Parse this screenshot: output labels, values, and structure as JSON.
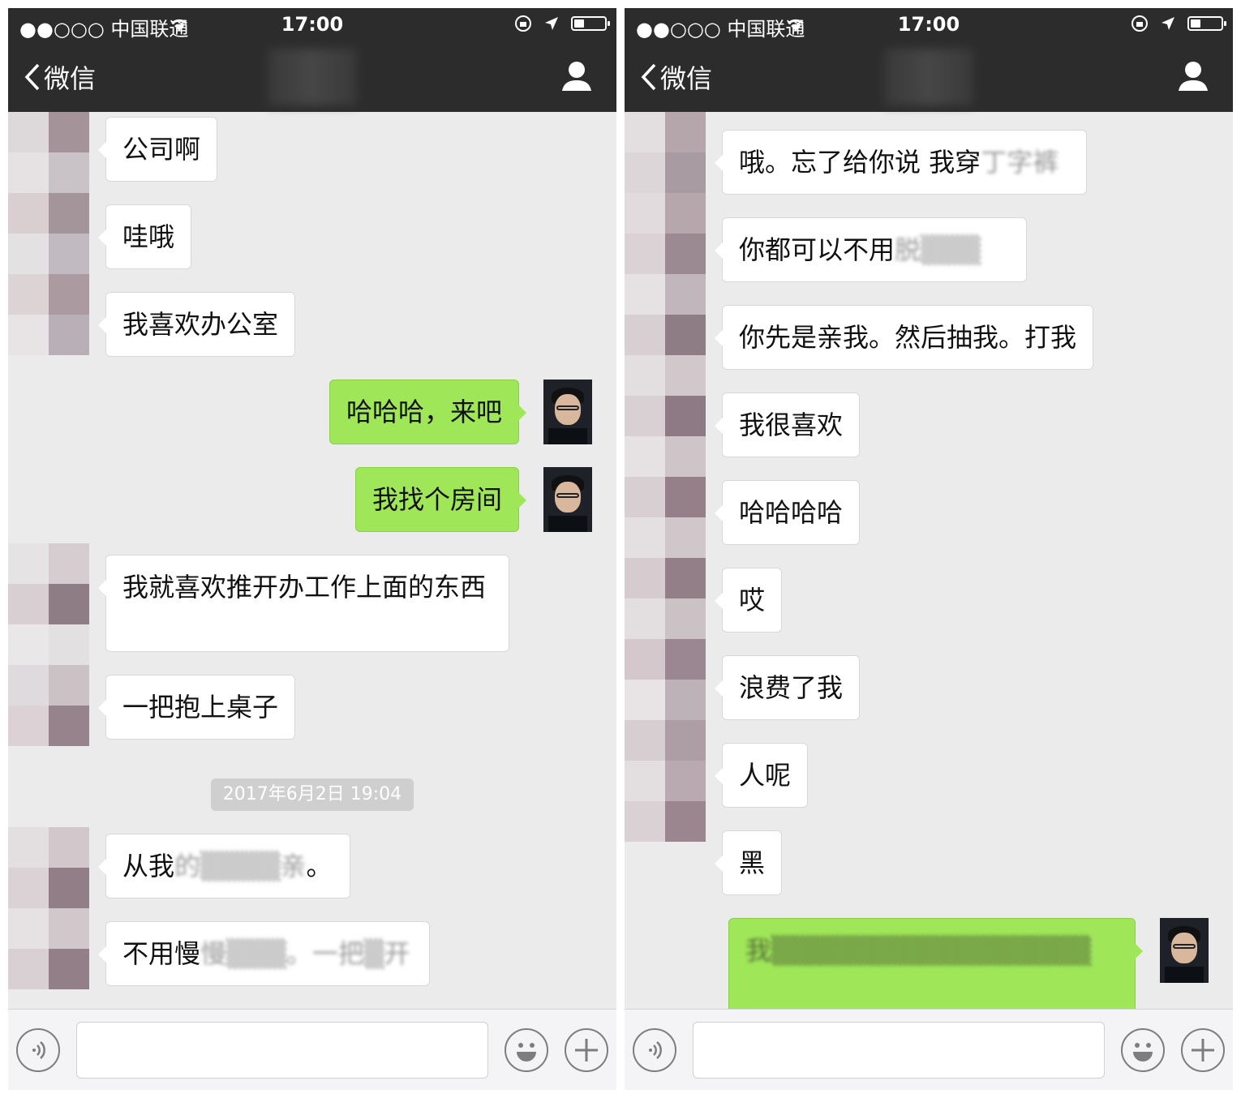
{
  "statusbar": {
    "carrier": "●●○○○ 中国联通",
    "time": "17:00",
    "battery_level": 0.35
  },
  "navbar": {
    "back_label": "微信"
  },
  "left": {
    "messages": [
      {
        "dir": "in",
        "text": "公司啊"
      },
      {
        "dir": "in",
        "text": "哇哦"
      },
      {
        "dir": "in",
        "text": "我喜欢办公室"
      },
      {
        "dir": "out",
        "text": "哈哈哈，来吧"
      },
      {
        "dir": "out",
        "text": "我找个房间"
      },
      {
        "dir": "in",
        "text": "我就喜欢推开办工作上面的东西"
      },
      {
        "dir": "in",
        "text": "一把抱上桌子"
      },
      {
        "dir": "in",
        "text": "从我",
        "blurred": "的▒▒▒▒亲",
        "suffix": "。"
      },
      {
        "dir": "in",
        "text": "不用慢",
        "blurred": "慢▒▒▒。一把▒开"
      }
    ],
    "timestamp": "2017年6月2日 19:04"
  },
  "right": {
    "messages": [
      {
        "dir": "in",
        "text": "哦。忘了给你说 我穿",
        "blurred": "丁字裤"
      },
      {
        "dir": "in",
        "text": "你都可以不用",
        "blurred": "脱▒▒▒"
      },
      {
        "dir": "in",
        "text": "你先是亲我。然后抽我。打我"
      },
      {
        "dir": "in",
        "text": "我很喜欢"
      },
      {
        "dir": "in",
        "text": "哈哈哈哈"
      },
      {
        "dir": "in",
        "text": "哎"
      },
      {
        "dir": "in",
        "text": "浪费了我"
      },
      {
        "dir": "in",
        "text": "人呢"
      },
      {
        "dir": "in",
        "text": "黑"
      },
      {
        "dir": "out",
        "text": "",
        "blurred": "我▒▒▒▒▒▒▒▒▒▒▒▒▒▒▒▒"
      }
    ]
  },
  "icons": {
    "back": "chevron-left-icon",
    "contact": "person-icon",
    "voice": "voice-icon",
    "emoji": "emoji-icon",
    "more": "plus-icon"
  },
  "colors": {
    "bubble_out": "#9fe659",
    "nav_bg": "#2c2c2c",
    "chat_bg": "#ebebeb"
  }
}
